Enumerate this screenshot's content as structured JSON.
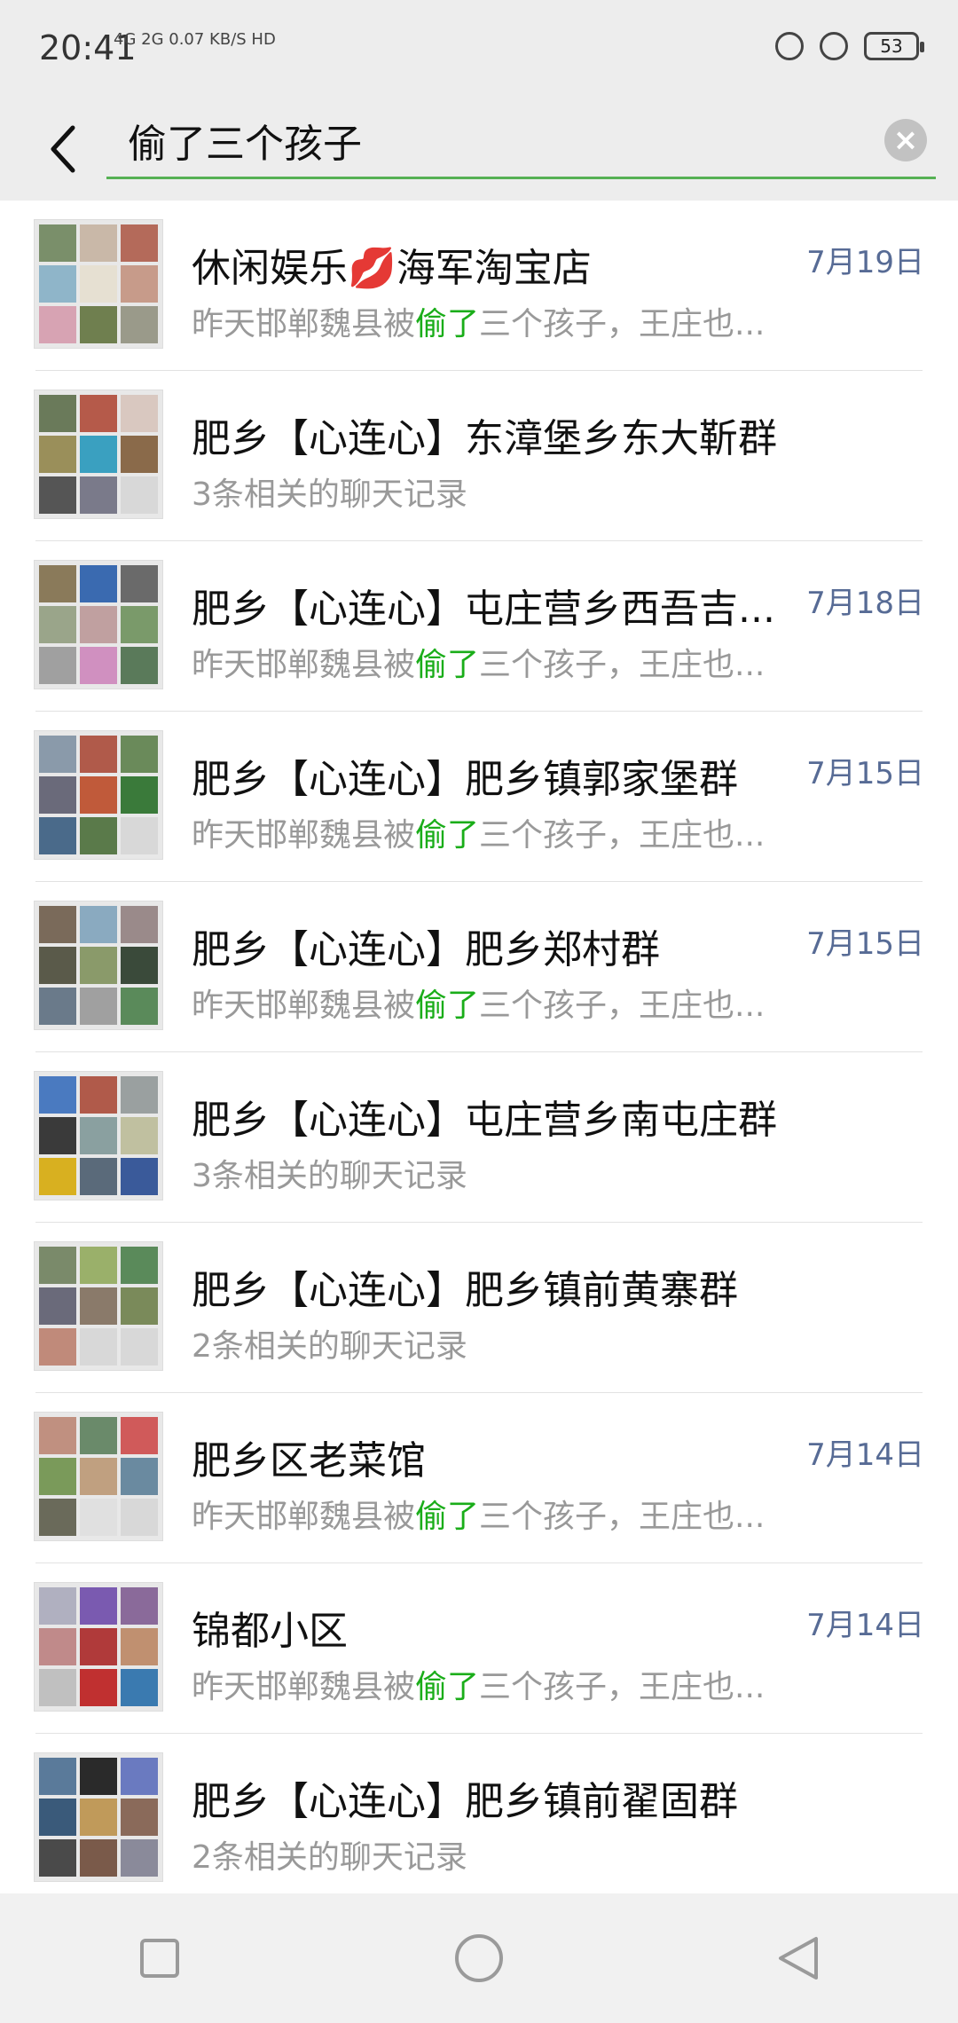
{
  "status": {
    "time": "20:41",
    "network": "4G 2G 0.07 KB/S HD",
    "battery": "53"
  },
  "search": {
    "query": "偷了三个孩子"
  },
  "results": [
    {
      "title": "休闲娱乐💋海军淘宝店",
      "date": "7月19日",
      "sub_prefix": "昨天邯郸魏县被",
      "sub_highlight": "偷了",
      "sub_suffix": "三个孩子，王庄也...",
      "colors": [
        "#7a8f6a",
        "#c9b8a8",
        "#b46a5a",
        "#8fb5c9",
        "#e6e0d2",
        "#c79b8a",
        "#d7a3b3",
        "#6f7f4f",
        "#9a9a8a"
      ]
    },
    {
      "title": "肥乡【心连心】东漳堡乡东大靳群",
      "date": "",
      "sub_prefix": "3条相关的聊天记录",
      "sub_highlight": "",
      "sub_suffix": "",
      "colors": [
        "#6a7a5a",
        "#b55a4a",
        "#d9c8c0",
        "#9a8f5a",
        "#3aa0c0",
        "#8a6a4a",
        "#555555",
        "#7a7a8a",
        "#d8d8d8"
      ]
    },
    {
      "title": "肥乡【心连心】屯庄营乡西吾吉...",
      "date": "7月18日",
      "sub_prefix": "昨天邯郸魏县被",
      "sub_highlight": "偷了",
      "sub_suffix": "三个孩子，王庄也...",
      "colors": [
        "#8a7a5a",
        "#3a6ab0",
        "#6a6a6a",
        "#9aa58a",
        "#c0a0a0",
        "#7a9a6a",
        "#a0a0a0",
        "#d090c0",
        "#5a7a5a"
      ]
    },
    {
      "title": "肥乡【心连心】肥乡镇郭家堡群",
      "date": "7月15日",
      "sub_prefix": "昨天邯郸魏县被",
      "sub_highlight": "偷了",
      "sub_suffix": "三个孩子，王庄也...",
      "colors": [
        "#8a9aaa",
        "#b05a4a",
        "#6a8a5a",
        "#6a6a7a",
        "#c05a3a",
        "#3a7a3a",
        "#4a6a8a",
        "#5a7a4a",
        "#d8d8d8"
      ]
    },
    {
      "title": "肥乡【心连心】肥乡郑村群",
      "date": "7月15日",
      "sub_prefix": "昨天邯郸魏县被",
      "sub_highlight": "偷了",
      "sub_suffix": "三个孩子，王庄也...",
      "colors": [
        "#7a6a5a",
        "#8aaac0",
        "#9a8a8a",
        "#5a5a4a",
        "#8a9a6a",
        "#3a4a3a",
        "#6a7a8a",
        "#a0a0a0",
        "#5a8a5a"
      ]
    },
    {
      "title": "肥乡【心连心】屯庄营乡南屯庄群",
      "date": "",
      "sub_prefix": "3条相关的聊天记录",
      "sub_highlight": "",
      "sub_suffix": "",
      "colors": [
        "#4a7ac0",
        "#b05a4a",
        "#9aa0a0",
        "#3a3a3a",
        "#8aa0a0",
        "#c0c0a0",
        "#d8b020",
        "#5a6a7a",
        "#3a5a9a"
      ]
    },
    {
      "title": "肥乡【心连心】肥乡镇前黄寨群",
      "date": "",
      "sub_prefix": "2条相关的聊天记录",
      "sub_highlight": "",
      "sub_suffix": "",
      "colors": [
        "#7a8a6a",
        "#9ab06a",
        "#5a8a5a",
        "#6a6a7a",
        "#8a7a6a",
        "#7a8a5a",
        "#c08a7a",
        "#d8d8d8",
        "#d8d8d8"
      ]
    },
    {
      "title": "肥乡区老菜馆",
      "date": "7月14日",
      "sub_prefix": "昨天邯郸魏县被",
      "sub_highlight": "偷了",
      "sub_suffix": "三个孩子，王庄也...",
      "colors": [
        "#c09080",
        "#6a8a6a",
        "#d05a5a",
        "#7a9a5a",
        "#c0a080",
        "#6a8aa0",
        "#6a6a5a",
        "#e0e0e0",
        "#d8d8d8"
      ]
    },
    {
      "title": "锦都小区",
      "date": "7月14日",
      "sub_prefix": "昨天邯郸魏县被",
      "sub_highlight": "偷了",
      "sub_suffix": "三个孩子，王庄也...",
      "colors": [
        "#b0b0c0",
        "#7a5ab0",
        "#8a6a9a",
        "#c08a8a",
        "#b03a3a",
        "#c09070",
        "#c0c0c0",
        "#c03030",
        "#3a7ab0"
      ]
    },
    {
      "title": "肥乡【心连心】肥乡镇前翟固群",
      "date": "",
      "sub_prefix": "2条相关的聊天记录",
      "sub_highlight": "",
      "sub_suffix": "",
      "colors": [
        "#5a7a9a",
        "#2a2a2a",
        "#6a7ac0",
        "#3a5a7a",
        "#c09a5a",
        "#8a6a5a",
        "#4a4a4a",
        "#7a5a4a",
        "#8a8a9a"
      ]
    }
  ]
}
